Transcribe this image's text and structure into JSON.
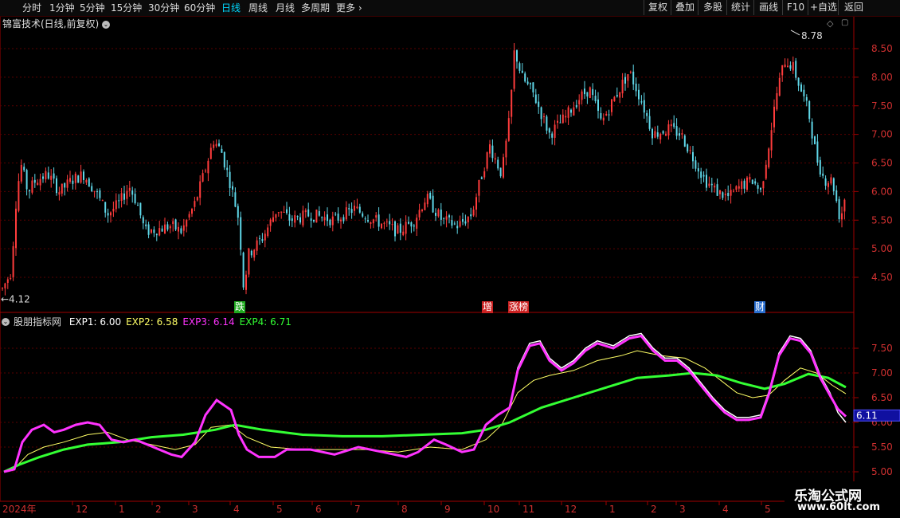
{
  "toolbar": {
    "periods": [
      "分时",
      "1分钟",
      "5分钟",
      "15分钟",
      "30分钟",
      "60分钟",
      "日线",
      "周线",
      "月线",
      "多周期",
      "更多"
    ],
    "active_period": "日线",
    "right_buttons": [
      "复权",
      "叠加",
      "多股",
      "统计",
      "画线",
      "F10",
      "+自选",
      "返回"
    ]
  },
  "main_panel": {
    "title": "锦富技术(日线,前复权)",
    "high_label": "8.78",
    "low_label": "4.12",
    "price_ticks": [
      "8.50",
      "8.00",
      "7.50",
      "7.00",
      "6.50",
      "6.00",
      "5.50",
      "5.00",
      "4.50"
    ],
    "event_tags": [
      {
        "text": "跌",
        "color": "#1faa1f"
      },
      {
        "text": "增",
        "color": "#cc2222"
      },
      {
        "text": "涨榜",
        "color": "#cc2222"
      },
      {
        "text": "财",
        "color": "#2a6fd0"
      }
    ]
  },
  "indicator_panel": {
    "name": "股朋指标网",
    "lines": [
      {
        "label": "EXP1: 6.00",
        "color": "#ffffff"
      },
      {
        "label": "EXP2: 6.58",
        "color": "#ffff66"
      },
      {
        "label": "EXP3: 6.14",
        "color": "#ff33ff"
      },
      {
        "label": "EXP4: 6.71",
        "color": "#33ff33"
      }
    ],
    "ticks": [
      "7.50",
      "7.00",
      "6.50",
      "6.00",
      "5.50",
      "5.00"
    ],
    "current_value": "6.11"
  },
  "x_axis": {
    "labels": [
      "2024年",
      "12",
      "1",
      "2",
      "3",
      "4",
      "5",
      "6",
      "7",
      "8",
      "9",
      "10",
      "11",
      "12",
      "1",
      "2",
      "3",
      "4",
      "5"
    ]
  },
  "watermark": {
    "line1": "乐淘公式网",
    "line2": "www.60lt.com"
  },
  "colors": {
    "up": "#ff3c3c",
    "down": "#5fd7e8",
    "grid": "#5a0000",
    "axis": "#a00000"
  }
}
